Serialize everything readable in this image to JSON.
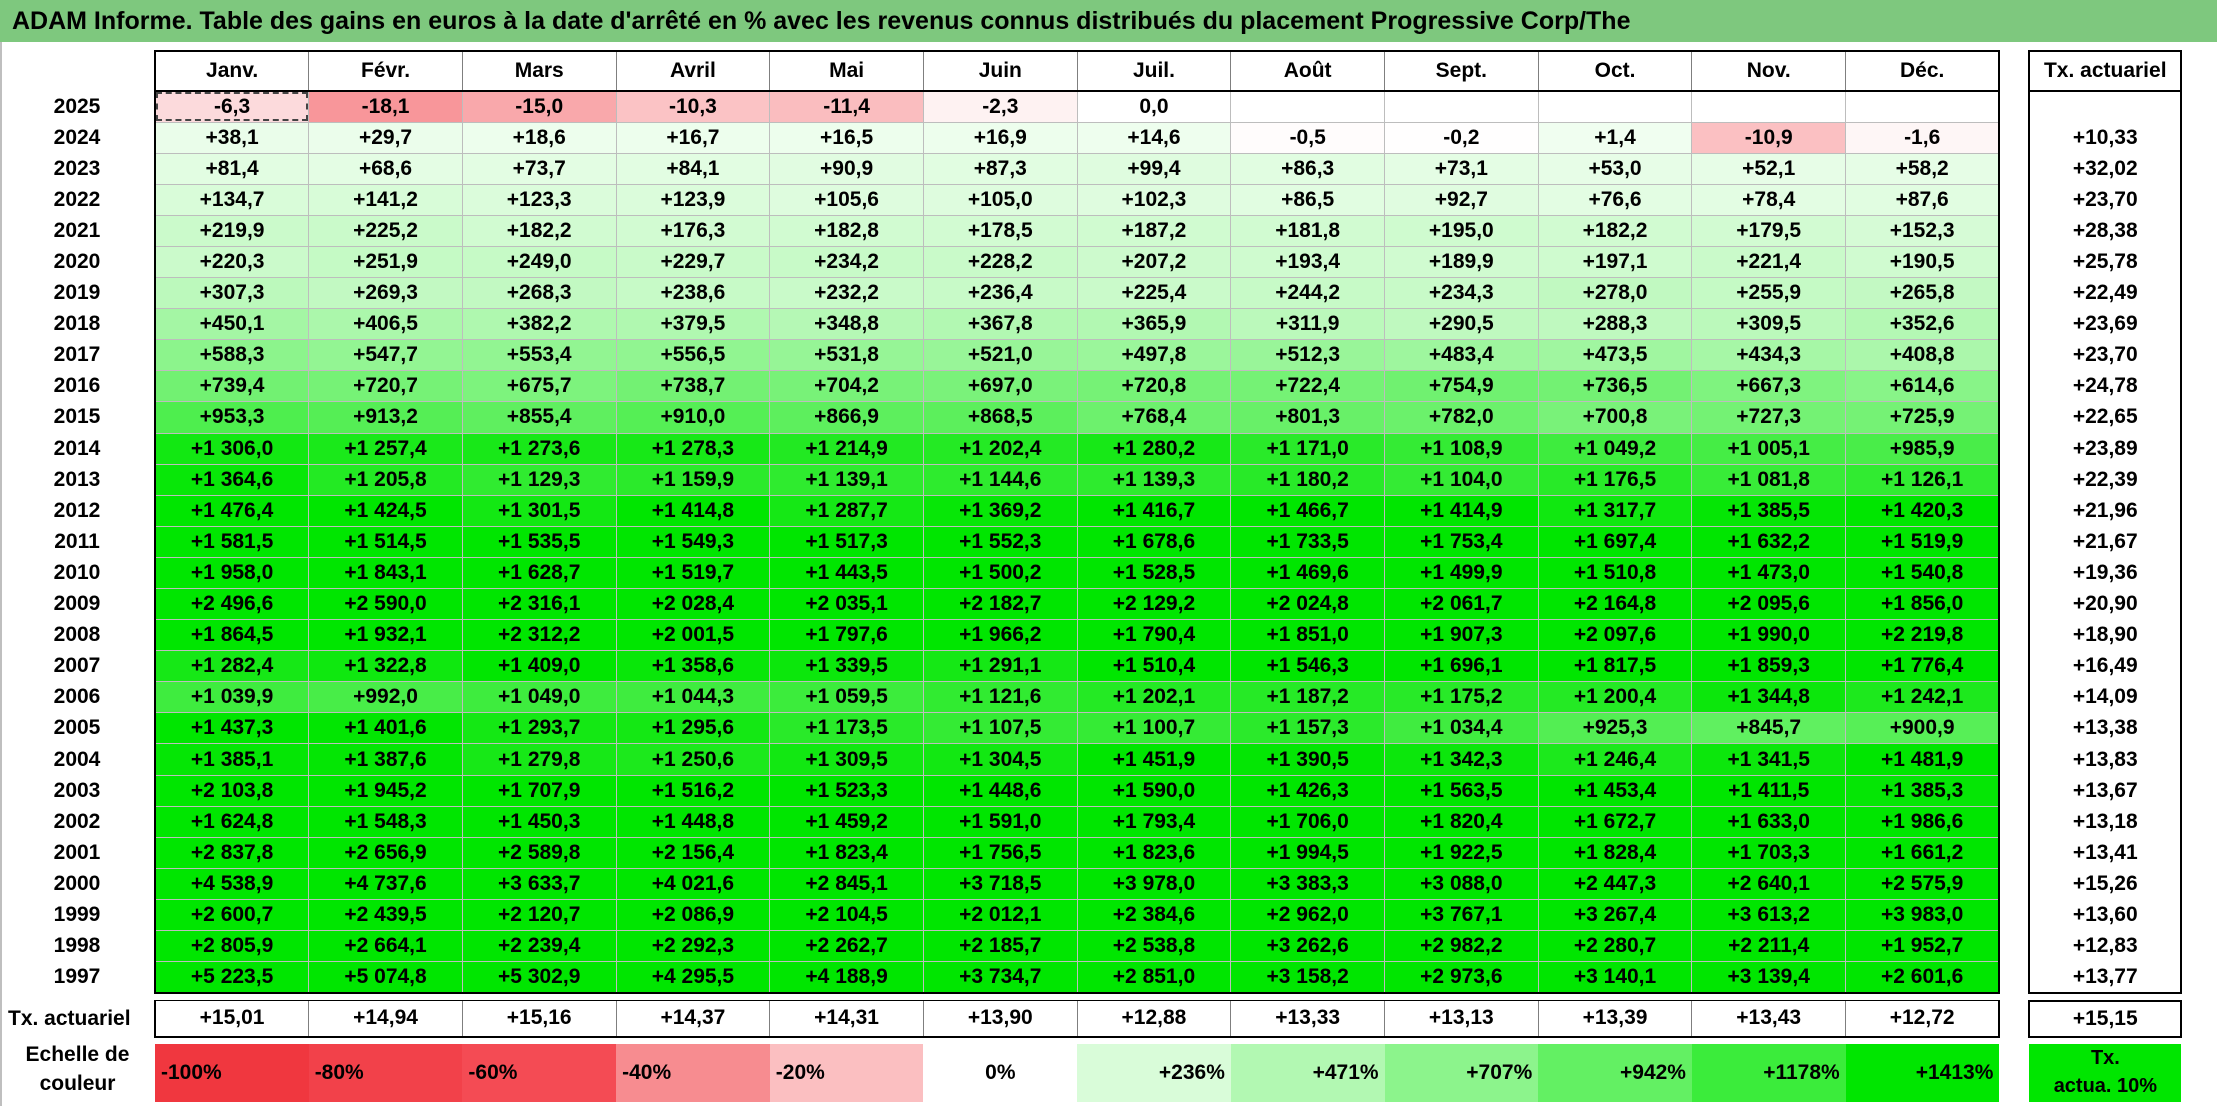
{
  "title": "ADAM Informe. Table des gains en euros à la date d'arrêté en % avec les revenus connus distribués du placement Progressive Corp/The",
  "months": [
    "Janv.",
    "Févr.",
    "Mars",
    "Avril",
    "Mai",
    "Juin",
    "Juil.",
    "Août",
    "Sept.",
    "Oct.",
    "Nov.",
    "Déc."
  ],
  "rate_header": "Tx. actuariel",
  "rows": [
    {
      "year": "2025",
      "values": [
        "-6,3",
        "-18,1",
        "-15,0",
        "-10,3",
        "-11,4",
        "-2,3",
        "0,0",
        "",
        "",
        "",
        "",
        ""
      ],
      "rate": ""
    },
    {
      "year": "2024",
      "values": [
        "+38,1",
        "+29,7",
        "+18,6",
        "+16,7",
        "+16,5",
        "+16,9",
        "+14,6",
        "-0,5",
        "-0,2",
        "+1,4",
        "-10,9",
        "-1,6"
      ],
      "rate": "+10,33"
    },
    {
      "year": "2023",
      "values": [
        "+81,4",
        "+68,6",
        "+73,7",
        "+84,1",
        "+90,9",
        "+87,3",
        "+99,4",
        "+86,3",
        "+73,1",
        "+53,0",
        "+52,1",
        "+58,2"
      ],
      "rate": "+32,02"
    },
    {
      "year": "2022",
      "values": [
        "+134,7",
        "+141,2",
        "+123,3",
        "+123,9",
        "+105,6",
        "+105,0",
        "+102,3",
        "+86,5",
        "+92,7",
        "+76,6",
        "+78,4",
        "+87,6"
      ],
      "rate": "+23,70"
    },
    {
      "year": "2021",
      "values": [
        "+219,9",
        "+225,2",
        "+182,2",
        "+176,3",
        "+182,8",
        "+178,5",
        "+187,2",
        "+181,8",
        "+195,0",
        "+182,2",
        "+179,5",
        "+152,3"
      ],
      "rate": "+28,38"
    },
    {
      "year": "2020",
      "values": [
        "+220,3",
        "+251,9",
        "+249,0",
        "+229,7",
        "+234,2",
        "+228,2",
        "+207,2",
        "+193,4",
        "+189,9",
        "+197,1",
        "+221,4",
        "+190,5"
      ],
      "rate": "+25,78"
    },
    {
      "year": "2019",
      "values": [
        "+307,3",
        "+269,3",
        "+268,3",
        "+238,6",
        "+232,2",
        "+236,4",
        "+225,4",
        "+244,2",
        "+234,3",
        "+278,0",
        "+255,9",
        "+265,8"
      ],
      "rate": "+22,49"
    },
    {
      "year": "2018",
      "values": [
        "+450,1",
        "+406,5",
        "+382,2",
        "+379,5",
        "+348,8",
        "+367,8",
        "+365,9",
        "+311,9",
        "+290,5",
        "+288,3",
        "+309,5",
        "+352,6"
      ],
      "rate": "+23,69"
    },
    {
      "year": "2017",
      "values": [
        "+588,3",
        "+547,7",
        "+553,4",
        "+556,5",
        "+531,8",
        "+521,0",
        "+497,8",
        "+512,3",
        "+483,4",
        "+473,5",
        "+434,3",
        "+408,8"
      ],
      "rate": "+23,70"
    },
    {
      "year": "2016",
      "values": [
        "+739,4",
        "+720,7",
        "+675,7",
        "+738,7",
        "+704,2",
        "+697,0",
        "+720,8",
        "+722,4",
        "+754,9",
        "+736,5",
        "+667,3",
        "+614,6"
      ],
      "rate": "+24,78"
    },
    {
      "year": "2015",
      "values": [
        "+953,3",
        "+913,2",
        "+855,4",
        "+910,0",
        "+866,9",
        "+868,5",
        "+768,4",
        "+801,3",
        "+782,0",
        "+700,8",
        "+727,3",
        "+725,9"
      ],
      "rate": "+22,65"
    },
    {
      "year": "2014",
      "values": [
        "+1 306,0",
        "+1 257,4",
        "+1 273,6",
        "+1 278,3",
        "+1 214,9",
        "+1 202,4",
        "+1 280,2",
        "+1 171,0",
        "+1 108,9",
        "+1 049,2",
        "+1 005,1",
        "+985,9"
      ],
      "rate": "+23,89"
    },
    {
      "year": "2013",
      "values": [
        "+1 364,6",
        "+1 205,8",
        "+1 129,3",
        "+1 159,9",
        "+1 139,1",
        "+1 144,6",
        "+1 139,3",
        "+1 180,2",
        "+1 104,0",
        "+1 176,5",
        "+1 081,8",
        "+1 126,1"
      ],
      "rate": "+22,39"
    },
    {
      "year": "2012",
      "values": [
        "+1 476,4",
        "+1 424,5",
        "+1 301,5",
        "+1 414,8",
        "+1 287,7",
        "+1 369,2",
        "+1 416,7",
        "+1 466,7",
        "+1 414,9",
        "+1 317,7",
        "+1 385,5",
        "+1 420,3"
      ],
      "rate": "+21,96"
    },
    {
      "year": "2011",
      "values": [
        "+1 581,5",
        "+1 514,5",
        "+1 535,5",
        "+1 549,3",
        "+1 517,3",
        "+1 552,3",
        "+1 678,6",
        "+1 733,5",
        "+1 753,4",
        "+1 697,4",
        "+1 632,2",
        "+1 519,9"
      ],
      "rate": "+21,67"
    },
    {
      "year": "2010",
      "values": [
        "+1 958,0",
        "+1 843,1",
        "+1 628,7",
        "+1 519,7",
        "+1 443,5",
        "+1 500,2",
        "+1 528,5",
        "+1 469,6",
        "+1 499,9",
        "+1 510,8",
        "+1 473,0",
        "+1 540,8"
      ],
      "rate": "+19,36"
    },
    {
      "year": "2009",
      "values": [
        "+2 496,6",
        "+2 590,0",
        "+2 316,1",
        "+2 028,4",
        "+2 035,1",
        "+2 182,7",
        "+2 129,2",
        "+2 024,8",
        "+2 061,7",
        "+2 164,8",
        "+2 095,6",
        "+1 856,0"
      ],
      "rate": "+20,90"
    },
    {
      "year": "2008",
      "values": [
        "+1 864,5",
        "+1 932,1",
        "+2 312,2",
        "+2 001,5",
        "+1 797,6",
        "+1 966,2",
        "+1 790,4",
        "+1 851,0",
        "+1 907,3",
        "+2 097,6",
        "+1 990,0",
        "+2 219,8"
      ],
      "rate": "+18,90"
    },
    {
      "year": "2007",
      "values": [
        "+1 282,4",
        "+1 322,8",
        "+1 409,0",
        "+1 358,6",
        "+1 339,5",
        "+1 291,1",
        "+1 510,4",
        "+1 546,3",
        "+1 696,1",
        "+1 817,5",
        "+1 859,3",
        "+1 776,4"
      ],
      "rate": "+16,49"
    },
    {
      "year": "2006",
      "values": [
        "+1 039,9",
        "+992,0",
        "+1 049,0",
        "+1 044,3",
        "+1 059,5",
        "+1 121,6",
        "+1 202,1",
        "+1 187,2",
        "+1 175,2",
        "+1 200,4",
        "+1 344,8",
        "+1 242,1"
      ],
      "rate": "+14,09"
    },
    {
      "year": "2005",
      "values": [
        "+1 437,3",
        "+1 401,6",
        "+1 293,7",
        "+1 295,6",
        "+1 173,5",
        "+1 107,5",
        "+1 100,7",
        "+1 157,3",
        "+1 034,4",
        "+925,3",
        "+845,7",
        "+900,9"
      ],
      "rate": "+13,38"
    },
    {
      "year": "2004",
      "values": [
        "+1 385,1",
        "+1 387,6",
        "+1 279,8",
        "+1 250,6",
        "+1 309,5",
        "+1 304,5",
        "+1 451,9",
        "+1 390,5",
        "+1 342,3",
        "+1 246,4",
        "+1 341,5",
        "+1 481,9"
      ],
      "rate": "+13,83"
    },
    {
      "year": "2003",
      "values": [
        "+2 103,8",
        "+1 945,2",
        "+1 707,9",
        "+1 516,2",
        "+1 523,3",
        "+1 448,6",
        "+1 590,0",
        "+1 426,3",
        "+1 563,5",
        "+1 453,4",
        "+1 411,5",
        "+1 385,3"
      ],
      "rate": "+13,67"
    },
    {
      "year": "2002",
      "values": [
        "+1 624,8",
        "+1 548,3",
        "+1 450,3",
        "+1 448,8",
        "+1 459,2",
        "+1 591,0",
        "+1 793,4",
        "+1 706,0",
        "+1 820,4",
        "+1 672,7",
        "+1 633,0",
        "+1 986,6"
      ],
      "rate": "+13,18"
    },
    {
      "year": "2001",
      "values": [
        "+2 837,8",
        "+2 656,9",
        "+2 589,8",
        "+2 156,4",
        "+1 823,4",
        "+1 756,5",
        "+1 823,6",
        "+1 994,5",
        "+1 922,5",
        "+1 828,4",
        "+1 703,3",
        "+1 661,2"
      ],
      "rate": "+13,41"
    },
    {
      "year": "2000",
      "values": [
        "+4 538,9",
        "+4 737,6",
        "+3 633,7",
        "+4 021,6",
        "+2 845,1",
        "+3 718,5",
        "+3 978,0",
        "+3 383,3",
        "+3 088,0",
        "+2 447,3",
        "+2 640,1",
        "+2 575,9"
      ],
      "rate": "+15,26"
    },
    {
      "year": "1999",
      "values": [
        "+2 600,7",
        "+2 439,5",
        "+2 120,7",
        "+2 086,9",
        "+2 104,5",
        "+2 012,1",
        "+2 384,6",
        "+2 962,0",
        "+3 767,1",
        "+3 267,4",
        "+3 613,2",
        "+3 983,0"
      ],
      "rate": "+13,60"
    },
    {
      "year": "1998",
      "values": [
        "+2 805,9",
        "+2 664,1",
        "+2 239,4",
        "+2 292,3",
        "+2 262,7",
        "+2 185,7",
        "+2 538,8",
        "+3 262,6",
        "+2 982,2",
        "+2 280,7",
        "+2 211,4",
        "+1 952,7"
      ],
      "rate": "+12,83"
    },
    {
      "year": "1997",
      "values": [
        "+5 223,5",
        "+5 074,8",
        "+5 302,9",
        "+4 295,5",
        "+4 188,9",
        "+3 734,7",
        "+2 851,0",
        "+3 158,2",
        "+2 973,6",
        "+3 140,1",
        "+3 139,4",
        "+2 601,6"
      ],
      "rate": "+13,77"
    }
  ],
  "summary": {
    "label": "Tx. actuariel",
    "values": [
      "+15,01",
      "+14,94",
      "+15,16",
      "+14,37",
      "+14,31",
      "+13,90",
      "+12,88",
      "+13,33",
      "+13,13",
      "+13,39",
      "+13,43",
      "+12,72"
    ],
    "rate": "+15,15"
  },
  "legend": {
    "label_line1": "Echelle de",
    "label_line2": "couleur",
    "items": [
      {
        "label": "-100%",
        "color": "#f0373f",
        "kind": "neg"
      },
      {
        "label": "-80%",
        "color": "#f2414a",
        "kind": "neg"
      },
      {
        "label": "-60%",
        "color": "#f44b54",
        "kind": "neg"
      },
      {
        "label": "-40%",
        "color": "#f78c90",
        "kind": "neg"
      },
      {
        "label": "-20%",
        "color": "#fbbfc1",
        "kind": "neg"
      },
      {
        "label": "0%",
        "color": "#ffffff",
        "kind": "zero"
      },
      {
        "label": "+236%",
        "color": "#d9fcd9",
        "kind": "pos"
      },
      {
        "label": "+471%",
        "color": "#b2f8b2",
        "kind": "pos"
      },
      {
        "label": "+707%",
        "color": "#8cf48c",
        "kind": "pos"
      },
      {
        "label": "+942%",
        "color": "#63f063",
        "kind": "pos"
      },
      {
        "label": "+1178%",
        "color": "#3bec3b",
        "kind": "pos"
      },
      {
        "label": "+1413%",
        "color": "#00e600",
        "kind": "pos"
      }
    ],
    "rate_line1": "Tx.",
    "rate_line2": "actua. 10%",
    "rate_color": "#00e600"
  },
  "colors": {
    "title_bar": "#7ec87e",
    "positive_max": "#00e600",
    "negative_max": "#f0373f"
  }
}
